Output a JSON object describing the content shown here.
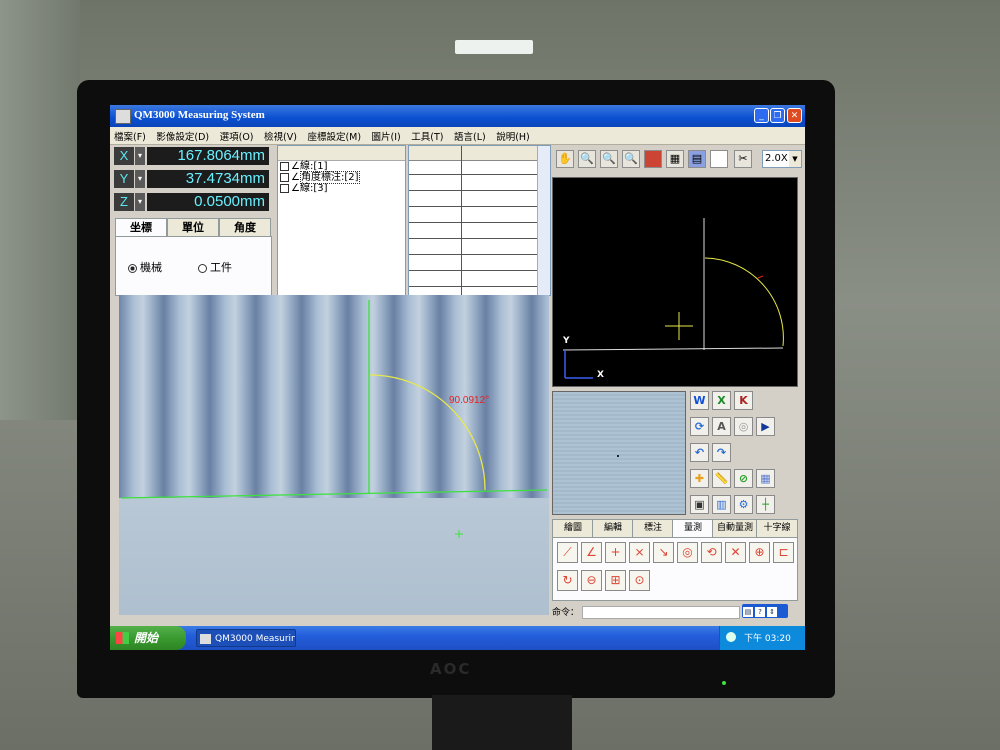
{
  "window": {
    "title": "QM3000 Measuring System"
  },
  "menu": [
    "檔案(F)",
    "影像設定(D)",
    "選項(O)",
    "檢視(V)",
    "座標設定(M)",
    "圖片(I)",
    "工具(T)",
    "語言(L)",
    "說明(H)"
  ],
  "coords": {
    "x": {
      "axis": "X",
      "value": "167.8064mm"
    },
    "y": {
      "axis": "Y",
      "value": "37.4734mm"
    },
    "z": {
      "axis": "Z",
      "value": "0.0500mm"
    }
  },
  "coord_tabs": [
    "坐標",
    "單位",
    "角度"
  ],
  "coord_options": {
    "machine": "機械",
    "workpiece": "工件"
  },
  "features": [
    "線:[1]",
    "角度標注:[2]",
    "線:[3]"
  ],
  "measurement": {
    "angle_label": "90.0912°"
  },
  "zoom": {
    "value": "2.0X"
  },
  "graphic_axes": {
    "x": "X",
    "y": "Y"
  },
  "bottom_tabs": [
    "繪圖",
    "編輯",
    "標注",
    "量測",
    "自動量測",
    "十字線"
  ],
  "command": {
    "label": "命令："
  },
  "taskbar": {
    "start": "開始",
    "task": "QM3000 Measuring S...",
    "clock": "下午 03:20"
  },
  "monitor": {
    "brand": "AOC"
  }
}
